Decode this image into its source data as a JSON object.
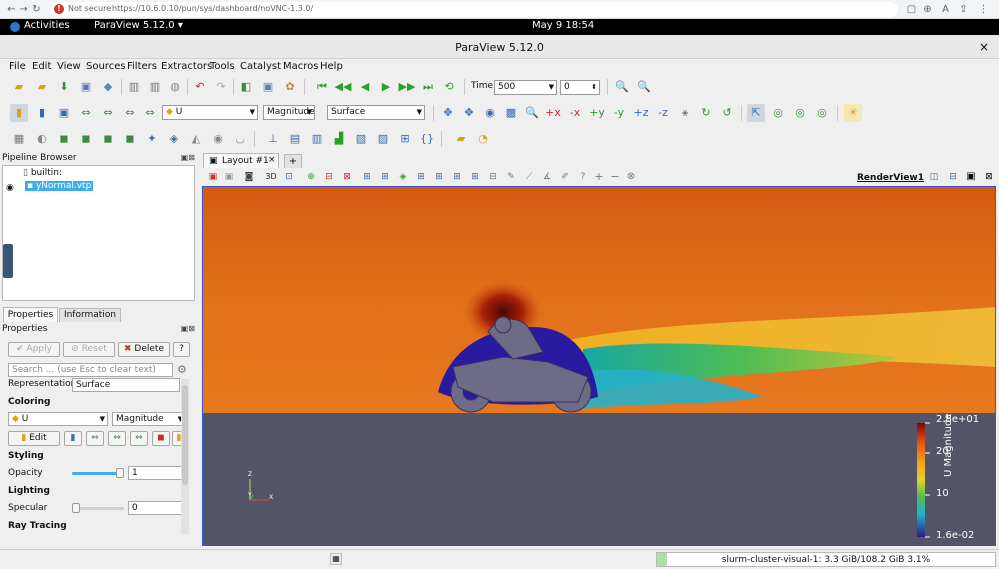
{
  "browser": {
    "security_label": "Not secure",
    "url": "https://10.6.0.10/pun/sys/dashboard/noVNC-1.3.0/"
  },
  "gnome": {
    "activities": "Activities",
    "app_menu": "ParaView 5.12.0 ▾",
    "clock": "May 9  18:54"
  },
  "window": {
    "title": "ParaView 5.12.0",
    "close": "×"
  },
  "menu": [
    "File",
    "Edit",
    "View",
    "Sources",
    "Filters",
    "Extractors",
    "Tools",
    "Catalyst",
    "Macros",
    "Help"
  ],
  "time_controls": {
    "time_label": "Time:",
    "time_value": "500",
    "step_value": "0"
  },
  "active_variables": {
    "array": "U",
    "component": "Magnitude",
    "representation": "Surface"
  },
  "pipeline_browser": {
    "title": "Pipeline Browser",
    "items": [
      {
        "label": "builtin:"
      },
      {
        "label": "yNormal.vtp"
      }
    ]
  },
  "properties_panel": {
    "tabs": [
      "Properties",
      "Information"
    ],
    "title": "Properties",
    "apply": "Apply",
    "reset": "Reset",
    "delete": "Delete",
    "help": "?",
    "search_placeholder": "Search ... (use Esc to clear text)",
    "representation_label": "Representation",
    "representation_value": "Surface",
    "coloring_title": "Coloring",
    "coloring_array": "U",
    "coloring_component": "Magnitude",
    "edit_label": "Edit",
    "styling_title": "Styling",
    "opacity_label": "Opacity",
    "opacity_value": "1",
    "opacity_level": 1.0,
    "lighting_title": "Lighting",
    "specular_label": "Specular",
    "specular_value": "0",
    "specular_level": 0.0,
    "ray_tracing_title": "Ray Tracing"
  },
  "layout": {
    "tab_label": "Layout #1",
    "close": "×",
    "add": "+",
    "view_name": "RenderView1",
    "mode_3d": "3D"
  },
  "color_legend": {
    "title": "U Magnitude",
    "max_label": "2.8e+01",
    "tick_20": "20",
    "tick_10": "10",
    "min_label": "1.6e-02"
  },
  "axes": {
    "z": "Z",
    "y": "Y",
    "x": "X"
  },
  "status": {
    "memory": "slurm-cluster-visual-1: 3.3 GiB/108.2 GiB 3.1%"
  },
  "colors": {
    "accent": "#3a52d8",
    "selection": "#3daee9",
    "background": "#535467"
  }
}
